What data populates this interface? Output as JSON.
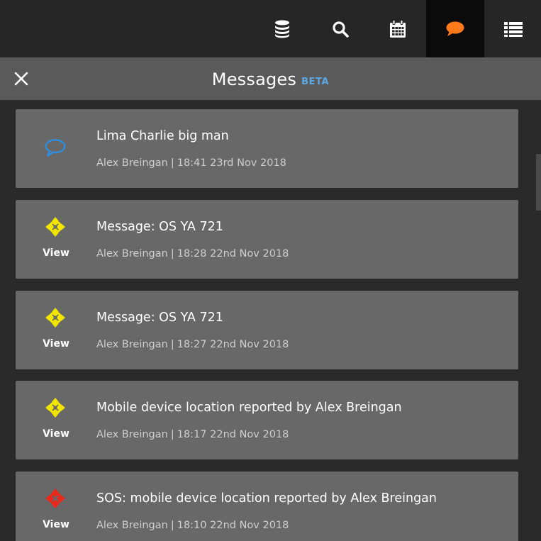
{
  "nav": {
    "items": [
      {
        "name": "database-icon",
        "active": false
      },
      {
        "name": "search-icon",
        "active": false
      },
      {
        "name": "calendar-icon",
        "active": false
      },
      {
        "name": "chat-icon",
        "active": true
      },
      {
        "name": "list-icon",
        "active": false
      }
    ]
  },
  "header": {
    "title": "Messages",
    "badge": "BETA",
    "close_icon": "close-icon"
  },
  "colors": {
    "accent_chat": "#ff7a1a",
    "beta_blue": "#5aa9e6",
    "marker_yellow": "#f2e600",
    "marker_red": "#e8291c",
    "card_bg": "#686868"
  },
  "messages": [
    {
      "icon": "chat-bubble-icon",
      "title": "Lima Charlie big man",
      "author": "Alex Breingan",
      "separator": "|",
      "time": "18:41 23rd Nov 2018",
      "view_label": ""
    },
    {
      "icon": "location-marker-icon",
      "title": "Message: OS YA 721",
      "author": "Alex Breingan",
      "separator": "|",
      "time": "18:28 22nd Nov 2018",
      "view_label": "View"
    },
    {
      "icon": "location-marker-icon",
      "title": "Message: OS YA 721",
      "author": "Alex Breingan",
      "separator": "|",
      "time": "18:27 22nd Nov 2018",
      "view_label": "View"
    },
    {
      "icon": "location-marker-icon",
      "title": "Mobile device location reported by Alex Breingan",
      "author": "Alex Breingan",
      "separator": "|",
      "time": "18:17 22nd Nov 2018",
      "view_label": "View"
    },
    {
      "icon": "sos-marker-icon",
      "title": "SOS: mobile device location reported by Alex Breingan",
      "author": "Alex Breingan",
      "separator": "|",
      "time": "18:10 22nd Nov 2018",
      "view_label": "View"
    }
  ]
}
